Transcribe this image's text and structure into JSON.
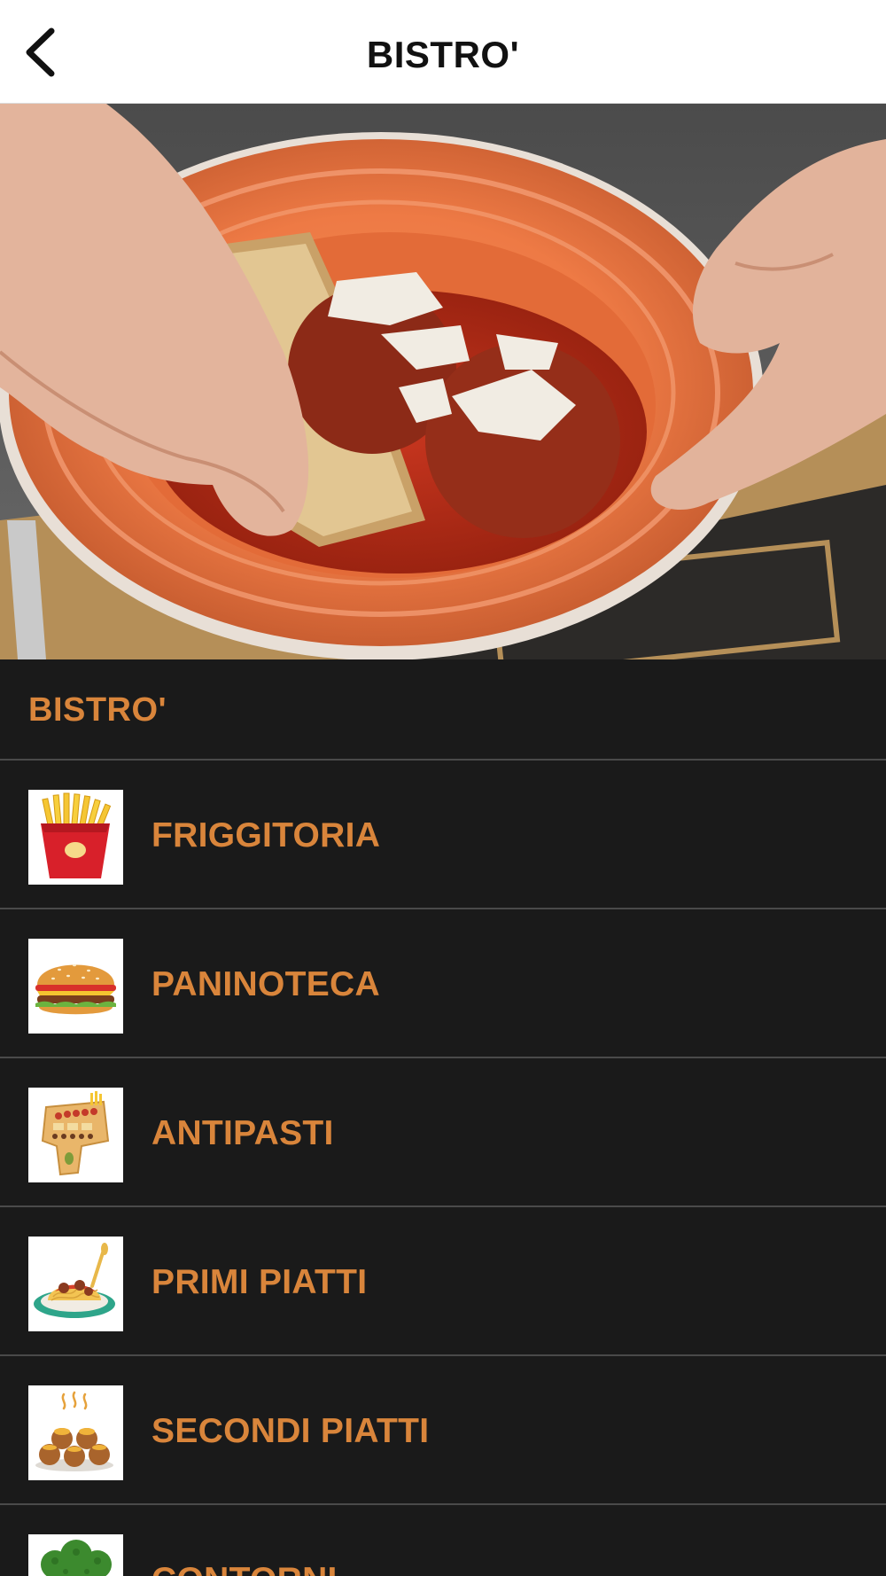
{
  "header": {
    "title": "BISTRO'",
    "back_icon": "chevron-left-icon"
  },
  "section": {
    "title": "BISTRO'"
  },
  "menu": {
    "items": [
      {
        "label": "FRIGGITORIA",
        "icon": "french-fries-icon"
      },
      {
        "label": "PANINOTECA",
        "icon": "burger-icon"
      },
      {
        "label": "ANTIPASTI",
        "icon": "appetizer-board-icon"
      },
      {
        "label": "PRIMI PIATTI",
        "icon": "spaghetti-plate-icon"
      },
      {
        "label": "SECONDI PIATTI",
        "icon": "meatballs-icon"
      },
      {
        "label": "CONTORNI",
        "icon": "broccoli-icon"
      }
    ]
  },
  "colors": {
    "accent": "#d9853b",
    "background": "#1a1a1a",
    "divider": "#4a4a4a",
    "header_bg": "#ffffff"
  }
}
